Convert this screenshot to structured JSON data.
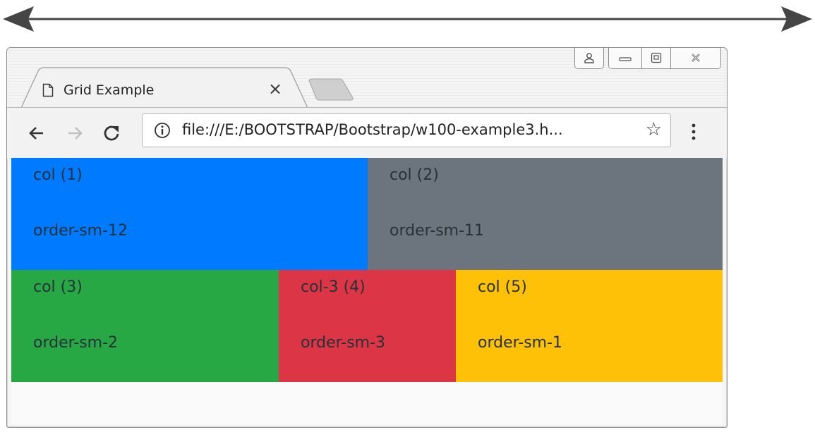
{
  "browser": {
    "tab": {
      "title": "Grid Example",
      "close_glyph": "×",
      "icon": "page-icon"
    },
    "new_tab_icon": "new-tab-icon",
    "toolbar": {
      "back_icon": "back-arrow-icon",
      "forward_icon": "forward-arrow-icon",
      "reload_icon": "reload-icon",
      "url": "file:///E:/BOOTSTRAP/Bootstrap/w100-example3.h...",
      "info_icon": "info-icon",
      "star_glyph": "☆",
      "menu_icon": "more-vert-icon"
    },
    "window_controls": [
      "user-icon",
      "minimize-icon",
      "maximize-icon",
      "close-icon"
    ]
  },
  "grid": {
    "rows": [
      {
        "cols": [
          {
            "label": "col (1)",
            "order": "order-sm-12",
            "color": "#007bff"
          },
          {
            "label": "col (2)",
            "order": "order-sm-11",
            "color": "#6c757d"
          }
        ]
      },
      {
        "cols": [
          {
            "label": "col (3)",
            "order": "order-sm-2",
            "color": "#28a745"
          },
          {
            "label": "col-3 (4)",
            "order": "order-sm-3",
            "color": "#dc3545"
          },
          {
            "label": "col (5)",
            "order": "order-sm-1",
            "color": "#ffc107"
          }
        ]
      }
    ]
  },
  "indicator": {
    "arrow_icon": "double-headed-arrow-icon"
  }
}
